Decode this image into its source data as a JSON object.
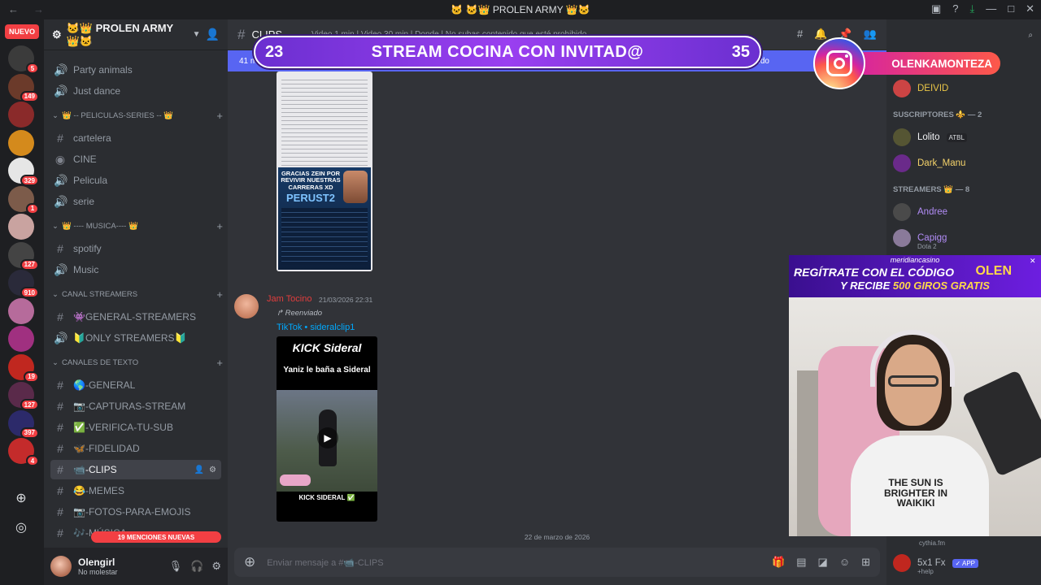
{
  "window": {
    "title": "🐱 🐱👑 PROLEN ARMY 👑🐱"
  },
  "servers": {
    "new_label": "NUEVO",
    "badges": [
      "5",
      "149",
      "",
      "",
      "329",
      "1",
      "",
      "127",
      "910",
      "",
      "",
      "19",
      "127",
      "397",
      "4"
    ]
  },
  "guild": {
    "name": "🐱👑 PROLEN ARMY 👑🐱"
  },
  "channels": {
    "items": [
      {
        "kind": "voice",
        "label": "Party animals"
      },
      {
        "kind": "voice",
        "label": "Just dance"
      },
      {
        "kind": "category",
        "label": "👑 -- PELICULAS-SERIES -- 👑"
      },
      {
        "kind": "text",
        "label": "cartelera"
      },
      {
        "kind": "stage",
        "label": "CINE"
      },
      {
        "kind": "voice",
        "label": "Pelicula"
      },
      {
        "kind": "voice",
        "label": "serie"
      },
      {
        "kind": "category",
        "label": "👑 ---- MUSICA---- 👑"
      },
      {
        "kind": "text",
        "label": "spotify"
      },
      {
        "kind": "voice",
        "label": "Music"
      },
      {
        "kind": "category",
        "label": "CANAL STREAMERS"
      },
      {
        "kind": "text",
        "label": "👾GENERAL-STREAMERS"
      },
      {
        "kind": "voice",
        "label": "🔰ONLY STREAMERS🔰"
      },
      {
        "kind": "category",
        "label": "CANALES DE TEXTO"
      },
      {
        "kind": "text",
        "label": "🌎-GENERAL"
      },
      {
        "kind": "text",
        "label": "📷-CAPTURAS-STREAM"
      },
      {
        "kind": "text",
        "label": "✅-VERIFICA-TU-SUB"
      },
      {
        "kind": "text",
        "label": "🦋-FIDELIDAD"
      },
      {
        "kind": "text",
        "label": "📹-CLIPS",
        "active": true
      },
      {
        "kind": "text",
        "label": "😂-MEMES"
      },
      {
        "kind": "text",
        "label": "📷-FOTOS-PARA-EMOJIS"
      },
      {
        "kind": "text",
        "label": "🎶-MÚSICA"
      }
    ],
    "mentions_label": "19 MENCIONES NUEVAS"
  },
  "user": {
    "name": "Olengirl",
    "status": "No molestar"
  },
  "header": {
    "channel": "CLIPS",
    "topic": "Video 1 min | Video 30 min | Donde | No subas contenido que esté prohibido"
  },
  "newbar": {
    "left": "41 m",
    "mark": "Marcar como leído"
  },
  "poster": {
    "line1": "GRACIAS ZEIN POR REVIVIR NUESTRAS CARRERAS XD",
    "line2": "PERUST2"
  },
  "message": {
    "author": "Jam Tocino",
    "time": "21/03/2026 22:31",
    "forwarded": "Reenviado",
    "link": "TikTok • sideralclip1",
    "video_title": "KICK Sideral",
    "video_caption": "Yaniz le baña a Sideral",
    "video_footer": "KICK SIDERAL ✅"
  },
  "divider": "22 de marzo de 2026",
  "composer": {
    "placeholder": "Enviar mensaje a #📹-CLIPS"
  },
  "members": {
    "sections": [
      {
        "title": "",
        "items": [
          {
            "name": "DEIVID",
            "color": "#e8c547"
          }
        ]
      },
      {
        "title": "SUSCRIPTORES ⚜️ — 2",
        "items": [
          {
            "name": "Lolito",
            "tag": "ATBL",
            "color": "#f2f3f5"
          },
          {
            "name": "Dark_Manu",
            "color": "#f5d36a"
          }
        ]
      },
      {
        "title": "STREAMERS 👑 — 8",
        "items": [
          {
            "name": "Andree",
            "color": "#b18cf5"
          },
          {
            "name": "Capigg",
            "sub": "Dota 2",
            "color": "#b18cf5"
          }
        ]
      }
    ],
    "bottom": {
      "name": "5x1 Fx",
      "app": "✓ APP",
      "sub": "+help",
      "top_sub": "cythia.fm"
    }
  },
  "overlay": {
    "left_num": "23",
    "title": "STREAM COCINA CON INVITAD@",
    "right_num": "35",
    "instagram": "OLENKAMONTEZA",
    "promo_brand": "meridiancasino",
    "promo_line1": "REGÍTRATE CON EL CÓDIGO",
    "promo_code": "OLEN",
    "promo_line2a": "Y RECIBE ",
    "promo_line2b": "500 GIROS GRATIS",
    "shirt": "THE SUN IS BRIGHTER IN WAIKIKI"
  }
}
